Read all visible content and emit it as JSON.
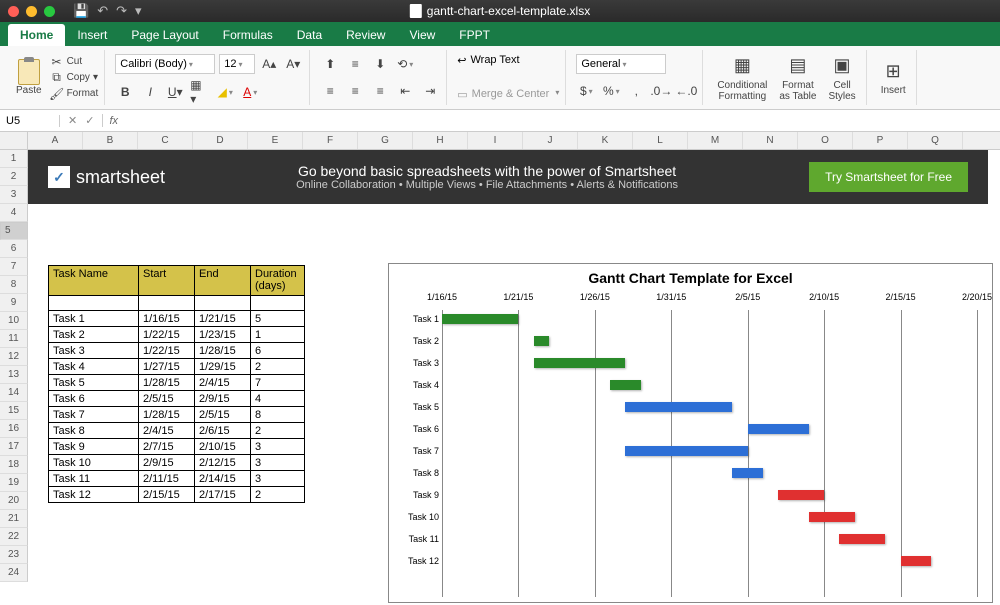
{
  "titlebar": {
    "filename": "gantt-chart-excel-template.xlsx"
  },
  "tabs": [
    "Home",
    "Insert",
    "Page Layout",
    "Formulas",
    "Data",
    "Review",
    "View",
    "FPPT"
  ],
  "active_tab": 0,
  "ribbon": {
    "paste": "Paste",
    "cut": "Cut",
    "copy": "Copy",
    "format": "Format",
    "font_name": "Calibri (Body)",
    "font_size": "12",
    "wrap_text": "Wrap Text",
    "merge_center": "Merge & Center",
    "number_format": "General",
    "conditional": "Conditional\nFormatting",
    "format_table": "Format\nas Table",
    "cell_styles": "Cell\nStyles",
    "insert": "Insert"
  },
  "namebox": "U5",
  "fx": "fx",
  "columns": [
    "A",
    "B",
    "C",
    "D",
    "E",
    "F",
    "G",
    "H",
    "I",
    "J",
    "K",
    "L",
    "M",
    "N",
    "O",
    "P",
    "Q"
  ],
  "rows": [
    1,
    2,
    3,
    4,
    5,
    6,
    7,
    8,
    9,
    10,
    11,
    12,
    13,
    14,
    15,
    16,
    17,
    18,
    19,
    20,
    21,
    22,
    23,
    24
  ],
  "selected_row": 5,
  "banner": {
    "brand": "smartsheet",
    "headline": "Go beyond basic spreadsheets with the power of Smartsheet",
    "sub": "Online Collaboration • Multiple Views • File Attachments • Alerts & Notifications",
    "cta": "Try Smartsheet for Free"
  },
  "task_headers": [
    "Task Name",
    "Start",
    "End",
    "Duration (days)"
  ],
  "tasks": [
    {
      "name": "Task 1",
      "start": "1/16/15",
      "end": "1/21/15",
      "dur": "5"
    },
    {
      "name": "Task 2",
      "start": "1/22/15",
      "end": "1/23/15",
      "dur": "1"
    },
    {
      "name": "Task 3",
      "start": "1/22/15",
      "end": "1/28/15",
      "dur": "6"
    },
    {
      "name": "Task 4",
      "start": "1/27/15",
      "end": "1/29/15",
      "dur": "2"
    },
    {
      "name": "Task 5",
      "start": "1/28/15",
      "end": "2/4/15",
      "dur": "7"
    },
    {
      "name": "Task 6",
      "start": "2/5/15",
      "end": "2/9/15",
      "dur": "4"
    },
    {
      "name": "Task 7",
      "start": "1/28/15",
      "end": "2/5/15",
      "dur": "8"
    },
    {
      "name": "Task 8",
      "start": "2/4/15",
      "end": "2/6/15",
      "dur": "2"
    },
    {
      "name": "Task 9",
      "start": "2/7/15",
      "end": "2/10/15",
      "dur": "3"
    },
    {
      "name": "Task 10",
      "start": "2/9/15",
      "end": "2/12/15",
      "dur": "3"
    },
    {
      "name": "Task 11",
      "start": "2/11/15",
      "end": "2/14/15",
      "dur": "3"
    },
    {
      "name": "Task 12",
      "start": "2/15/15",
      "end": "2/17/15",
      "dur": "2"
    }
  ],
  "chart_data": {
    "type": "bar",
    "title": "Gantt Chart Template for Excel",
    "x_ticks": [
      "1/16/15",
      "1/21/15",
      "1/26/15",
      "1/31/15",
      "2/5/15",
      "2/10/15",
      "2/15/15",
      "2/20/15"
    ],
    "x_min": 0,
    "x_max": 35,
    "series_colors": {
      "g": "#2a8a2a",
      "b": "#2d6fd6",
      "r": "#e03030"
    },
    "bars": [
      {
        "label": "Task 1",
        "start": 0,
        "dur": 5,
        "cls": "g"
      },
      {
        "label": "Task 2",
        "start": 6,
        "dur": 1,
        "cls": "g"
      },
      {
        "label": "Task 3",
        "start": 6,
        "dur": 6,
        "cls": "g"
      },
      {
        "label": "Task 4",
        "start": 11,
        "dur": 2,
        "cls": "g"
      },
      {
        "label": "Task 5",
        "start": 12,
        "dur": 7,
        "cls": "b"
      },
      {
        "label": "Task 6",
        "start": 20,
        "dur": 4,
        "cls": "b"
      },
      {
        "label": "Task 7",
        "start": 12,
        "dur": 8,
        "cls": "b"
      },
      {
        "label": "Task 8",
        "start": 19,
        "dur": 2,
        "cls": "b"
      },
      {
        "label": "Task 9",
        "start": 22,
        "dur": 3,
        "cls": "r"
      },
      {
        "label": "Task 10",
        "start": 24,
        "dur": 3,
        "cls": "r"
      },
      {
        "label": "Task 11",
        "start": 26,
        "dur": 3,
        "cls": "r"
      },
      {
        "label": "Task 12",
        "start": 30,
        "dur": 2,
        "cls": "r"
      }
    ]
  }
}
